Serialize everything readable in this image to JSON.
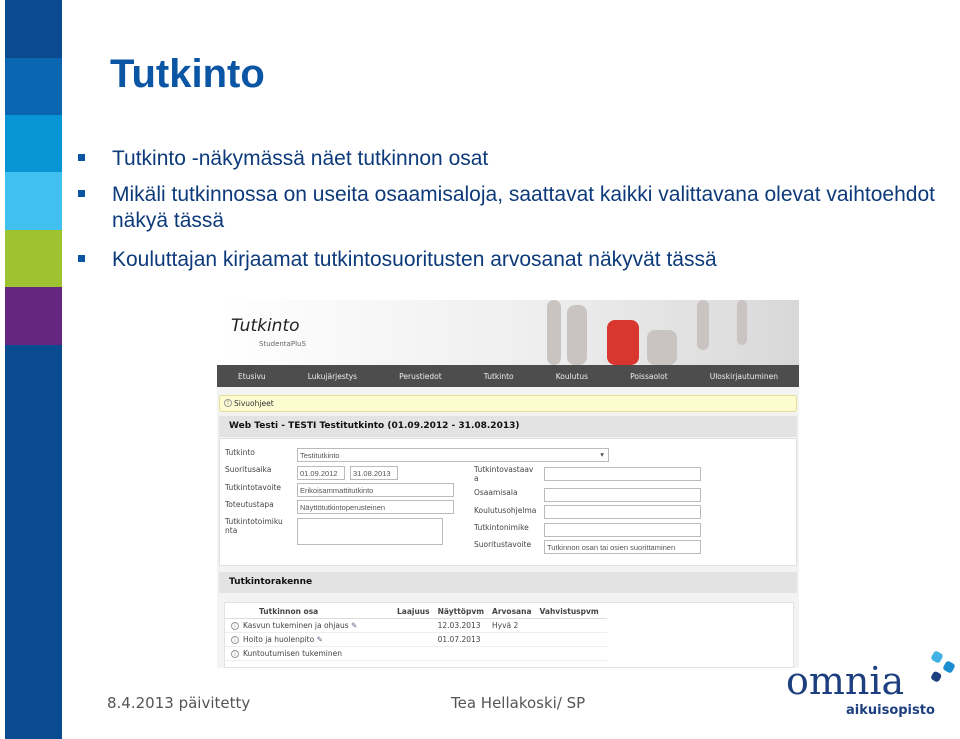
{
  "slide": {
    "title": "Tutkinto",
    "bullets": [
      "Tutkinto -näkymässä näet tutkinnon osat",
      "Mikäli tutkinnossa on useita osaamisaloja, saattavat kaikki valittavana olevat vaihtoehdot näkyä tässä",
      "Kouluttajan kirjaamat tutkintosuoritusten arvosanat näkyvät tässä"
    ],
    "footer_left": "8.4.2013 päivitetty",
    "footer_center": "Tea Hellakoski/ SP",
    "logo": {
      "name": "omnia",
      "sub": "aikuisopisto"
    },
    "colors": {
      "accent": "#0b56a4",
      "bands": [
        "#0b4a8f",
        "#0a66b0",
        "#0895d6",
        "#3fc0ee",
        "#9dc330",
        "#64267e",
        "#0a4a8f"
      ]
    }
  },
  "screenshot": {
    "app_title": "Tutkinto",
    "app_sub": "StudentaPluS",
    "nav": [
      "Etusivu",
      "Lukujärjestys",
      "Perustiedot",
      "Tutkinto",
      "Koulutus",
      "Poissaolot",
      "Uloskirjautuminen"
    ],
    "help": "Sivuohjeet",
    "section1": "Web Testi - TESTI Testitutkinto (01.09.2012 - 31.08.2013)",
    "form": {
      "tutkinto_label": "Tutkinto",
      "tutkinto_value": "Testitutkinto",
      "suoritusaika_label": "Suoritusaika",
      "start": "01.09.2012",
      "end": "31.08.2013",
      "tavoite_label": "Tutkintotavoite",
      "tavoite_value": "Erikoisammattitutkinto",
      "toteutus_label": "Toteutustapa",
      "toteutus_value": "Näyttötutkintoperusteinen",
      "toimikunta_label": "Tutkintotoimiku nta",
      "vastaava_label": "Tutkintovastaav a",
      "osaamisala_label": "Osaamisala",
      "ohjelma_label": "Koulutusohjelma",
      "nimike_label": "Tutkintonimike",
      "suoritustavoite_label": "Suoritustavoite",
      "suoritustavoite_value": "Tutkinnon osan tai osien suorittaminen"
    },
    "section2": "Tutkintorakenne",
    "table": {
      "headers": [
        "Tutkinnon osa",
        "Laajuus",
        "Näyttöpvm",
        "Arvosana",
        "Vahvistuspvm"
      ],
      "rows": [
        {
          "osa": "Kasvun tukeminen ja ohjaus",
          "laajuus": "",
          "pvm": "12.03.2013",
          "arvosana": "Hyvä 2",
          "vahvistus": "",
          "edit": true
        },
        {
          "osa": "Hoito ja huolenpito",
          "laajuus": "",
          "pvm": "01.07.2013",
          "arvosana": "",
          "vahvistus": "",
          "edit": true
        },
        {
          "osa": "Kuntoutumisen tukeminen",
          "laajuus": "",
          "pvm": "",
          "arvosana": "",
          "vahvistus": "",
          "edit": false
        }
      ]
    }
  }
}
